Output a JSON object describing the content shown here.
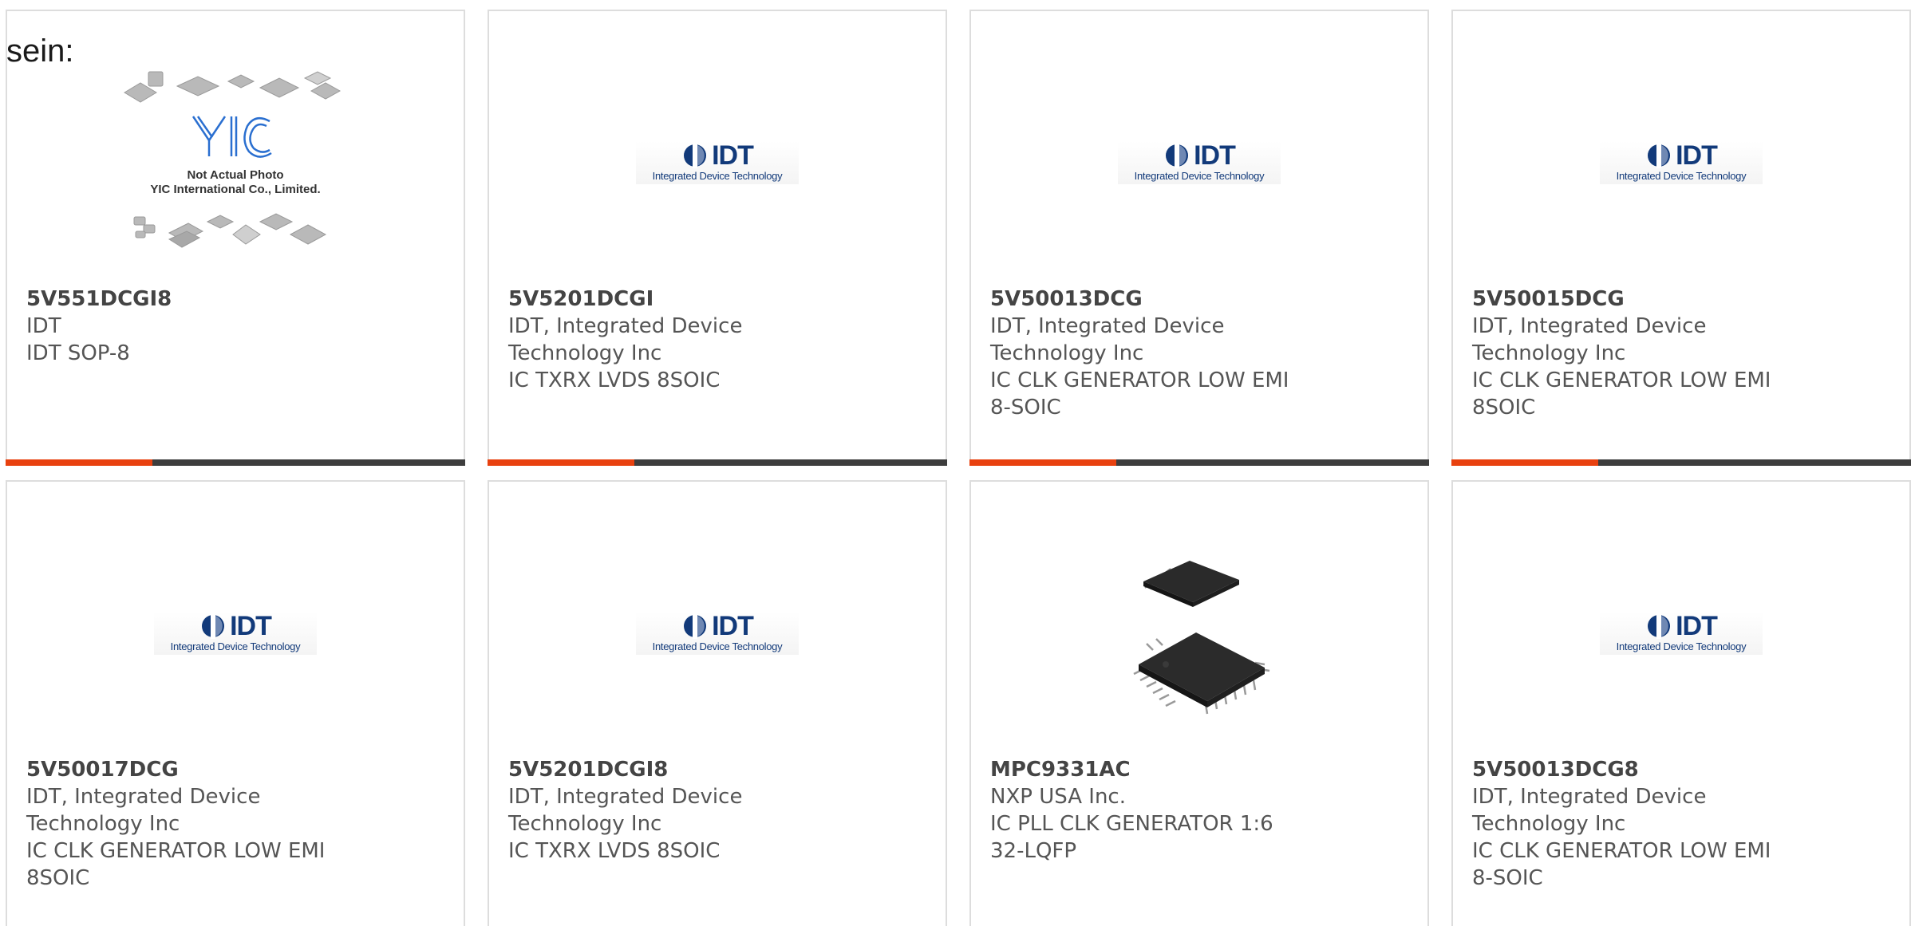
{
  "lead_text": "sein:",
  "colors": {
    "accent_bar": "#e8410f",
    "rest_bar": "#3d3d3d",
    "logo_blue": "#123a7a"
  },
  "placeholder_image": {
    "caption_line1": "Not Actual Photo",
    "caption_line2": "YIC International Co., Limited.",
    "logo_text": "YIC"
  },
  "idt_logo": {
    "wordmark": "IDT",
    "tagline": "Integrated Device Technology"
  },
  "products": [
    {
      "part_number": "5V551DCGI8",
      "manufacturer": "IDT",
      "description": "IDT SOP-8",
      "image": "yic-placeholder"
    },
    {
      "part_number": "5V5201DCGI",
      "manufacturer": "IDT, Integrated Device Technology Inc",
      "description": "IC TXRX LVDS 8SOIC",
      "image": "idt-logo"
    },
    {
      "part_number": "5V50013DCG",
      "manufacturer": "IDT, Integrated Device Technology Inc",
      "description": "IC CLK GENERATOR LOW EMI 8-SOIC",
      "image": "idt-logo"
    },
    {
      "part_number": "5V50015DCG",
      "manufacturer": "IDT, Integrated Device Technology Inc",
      "description": "IC CLK GENERATOR LOW EMI 8SOIC",
      "image": "idt-logo"
    },
    {
      "part_number": "5V50017DCG",
      "manufacturer": "IDT, Integrated Device Technology Inc",
      "description": "IC CLK GENERATOR LOW EMI 8SOIC",
      "image": "idt-logo"
    },
    {
      "part_number": "5V5201DCGI8",
      "manufacturer": "IDT, Integrated Device Technology Inc",
      "description": "IC TXRX LVDS 8SOIC",
      "image": "idt-logo"
    },
    {
      "part_number": "MPC9331AC",
      "manufacturer": "NXP USA Inc.",
      "description": "IC PLL CLK GENERATOR 1:6 32-LQFP",
      "image": "lqfp-chip-photo"
    },
    {
      "part_number": "5V50013DCG8",
      "manufacturer": "IDT, Integrated Device Technology Inc",
      "description": "IC CLK GENERATOR LOW EMI 8-SOIC",
      "image": "idt-logo"
    }
  ]
}
